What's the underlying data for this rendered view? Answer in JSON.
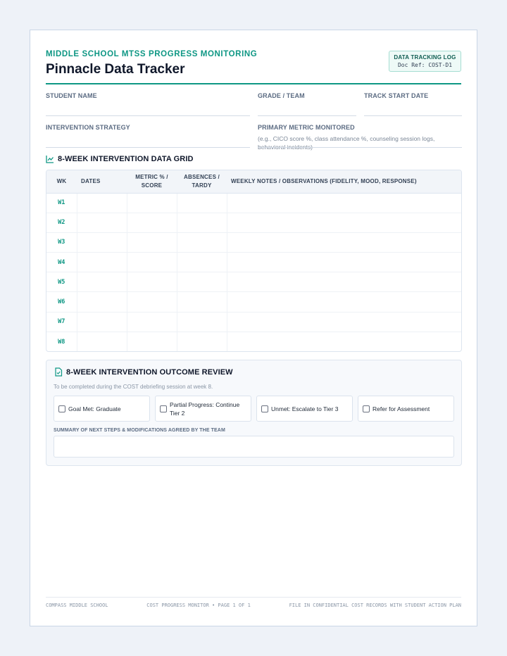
{
  "header": {
    "subtitle": "MIDDLE SCHOOL MTSS PROGRESS MONITORING",
    "title": "Pinnacle Data Tracker",
    "doc_label": "DATA TRACKING LOG",
    "doc_ref": "Doc Ref: COST-D1"
  },
  "fields": {
    "student_name": "STUDENT NAME",
    "grade_team": "GRADE / TEAM",
    "track_start": "TRACK START DATE",
    "strategy": "INTERVENTION STRATEGY",
    "metric": "PRIMARY METRIC MONITORED",
    "metric_hint": "(e.g., CICO score %, class attendance %, counseling session logs, behavioral incidents)"
  },
  "grid": {
    "heading": "8-WEEK INTERVENTION DATA GRID",
    "columns": {
      "wk": "WK",
      "dates": "DATES",
      "metric_1": "METRIC % /",
      "metric_2": "SCORE",
      "absences_1": "ABSENCES /",
      "absences_2": "TARDY",
      "notes": "WEEKLY NOTES / OBSERVATIONS (FIDELITY, MOOD, RESPONSE)"
    },
    "weeks": [
      "W1",
      "W2",
      "W3",
      "W4",
      "W5",
      "W6",
      "W7",
      "W8"
    ]
  },
  "outcome": {
    "heading": "8-WEEK INTERVENTION OUTCOME REVIEW",
    "note": "To be completed during the COST debriefing session at week 8.",
    "options": [
      "Goal Met: Graduate",
      "Partial Progress: Continue Tier 2",
      "Unmet: Escalate to Tier 3",
      "Refer for Assessment"
    ],
    "summary_label": "SUMMARY OF NEXT STEPS & MODIFICATIONS AGREED BY THE TEAM"
  },
  "footer": {
    "left": "COMPASS MIDDLE SCHOOL",
    "center": "COST PROGRESS MONITOR • PAGE 1 OF 1",
    "right": "FILE IN CONFIDENTIAL COST RECORDS WITH STUDENT ACTION PLAN"
  },
  "colors": {
    "accent": "#0e9784",
    "border": "#c9d6e6"
  }
}
